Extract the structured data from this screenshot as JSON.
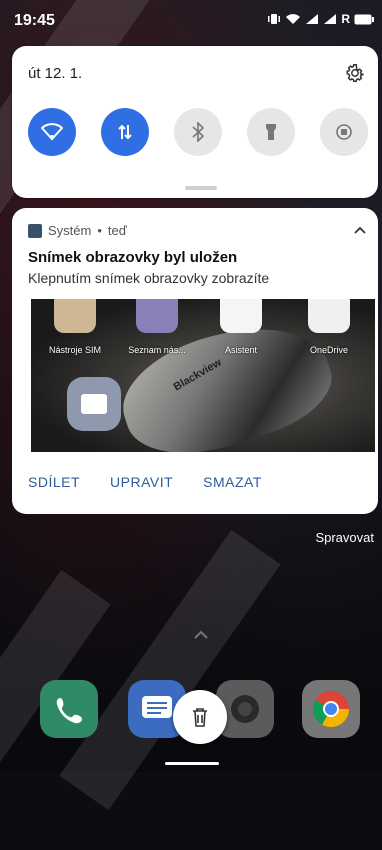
{
  "status_bar": {
    "time": "19:45",
    "icons": [
      "vibrate-icon",
      "wifi-icon",
      "signal-icon",
      "signal-icon",
      "battery-icon"
    ],
    "network_label": "R"
  },
  "quick_settings": {
    "date": "út 12. 1.",
    "tiles": [
      {
        "name": "wifi",
        "state": "on"
      },
      {
        "name": "mobile-data",
        "state": "on"
      },
      {
        "name": "bluetooth",
        "state": "off"
      },
      {
        "name": "flashlight",
        "state": "off"
      },
      {
        "name": "auto-rotate",
        "state": "off"
      }
    ],
    "accent_color": "#2f6fe3"
  },
  "notification": {
    "app_name": "Systém",
    "separator": "•",
    "time": "teď",
    "title": "Snímek obrazovky byl uložen",
    "body": "Klepnutím snímek obrazovky zobrazíte",
    "preview": {
      "apps": [
        "Nástroje SIM",
        "Seznam nás...",
        "Asistent",
        "OneDrive"
      ],
      "brand_text": "Blackview"
    },
    "actions": [
      "SDÍLET",
      "UPRAVIT",
      "SMAZAT"
    ]
  },
  "manage_label": "Spravovat",
  "dock": [
    "phone",
    "messages",
    "camera",
    "chrome"
  ]
}
